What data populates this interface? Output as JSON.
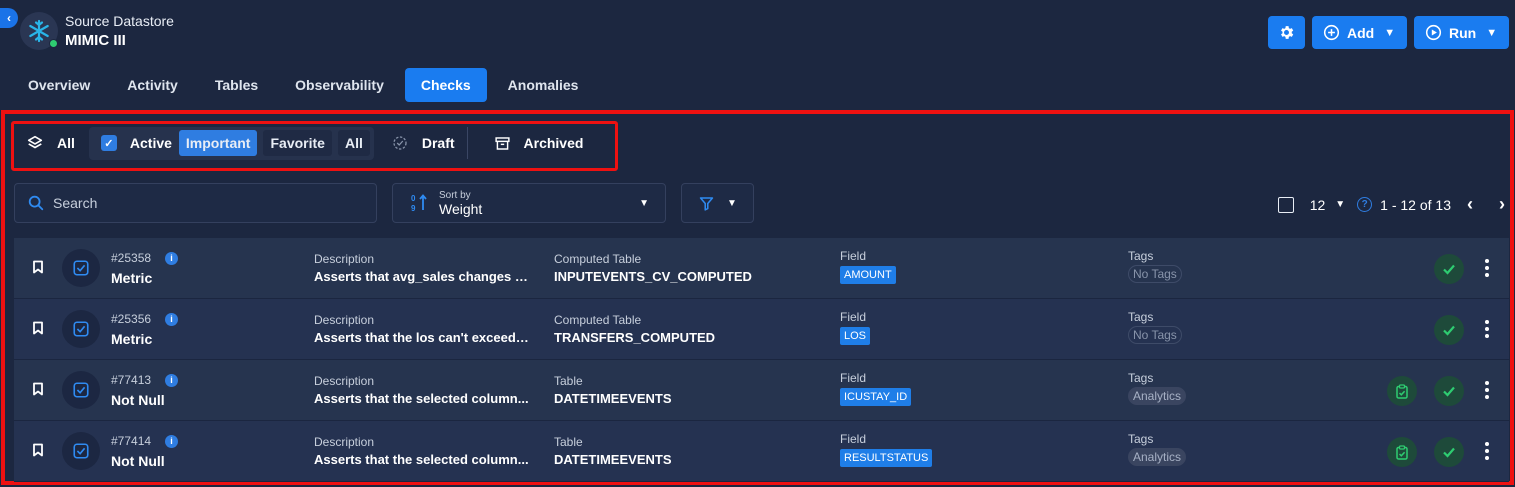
{
  "header": {
    "subtitle": "Source Datastore",
    "title": "MIMIC III"
  },
  "actions": {
    "add_label": "Add",
    "run_label": "Run"
  },
  "tabs": [
    {
      "label": "Overview",
      "active": false
    },
    {
      "label": "Activity",
      "active": false
    },
    {
      "label": "Tables",
      "active": false
    },
    {
      "label": "Observability",
      "active": false
    },
    {
      "label": "Checks",
      "active": true
    },
    {
      "label": "Anomalies",
      "active": false
    }
  ],
  "filters": {
    "all": "All",
    "active": "Active",
    "important": "Important",
    "favorite": "Favorite",
    "active_all": "All",
    "draft": "Draft",
    "archived": "Archived"
  },
  "search": {
    "placeholder": "Search"
  },
  "sort": {
    "label": "Sort by",
    "value": "Weight"
  },
  "pager": {
    "per_page": "12",
    "range": "1 - 12 of 13"
  },
  "columns": {
    "description": "Description",
    "field": "Field",
    "tags": "Tags"
  },
  "rows": [
    {
      "id": "#25358",
      "type": "Metric",
      "description": "Asserts that avg_sales changes b...",
      "table_label": "Computed Table",
      "table": "INPUTEVENTS_CV_COMPUTED",
      "field": "AMOUNT",
      "tag": "No Tags"
    },
    {
      "id": "#25356",
      "type": "Metric",
      "description": "Asserts that the los can't exceed t...",
      "table_label": "Computed Table",
      "table": "TRANSFERS_COMPUTED",
      "field": "LOS",
      "tag": "No Tags"
    },
    {
      "id": "#77413",
      "type": "Not Null",
      "description": "Asserts that the selected column...",
      "table_label": "Table",
      "table": "DATETIMEEVENTS",
      "field": "ICUSTAY_ID",
      "tag": "Analytics"
    },
    {
      "id": "#77414",
      "type": "Not Null",
      "description": "Asserts that the selected column...",
      "table_label": "Table",
      "table": "DATETIMEEVENTS",
      "field": "RESULTSTATUS",
      "tag": "Analytics"
    }
  ],
  "colors": {
    "accent": "#1a7cf0",
    "background": "#1c2740",
    "highlight_border": "#ee1111",
    "success": "#2ecc71"
  }
}
